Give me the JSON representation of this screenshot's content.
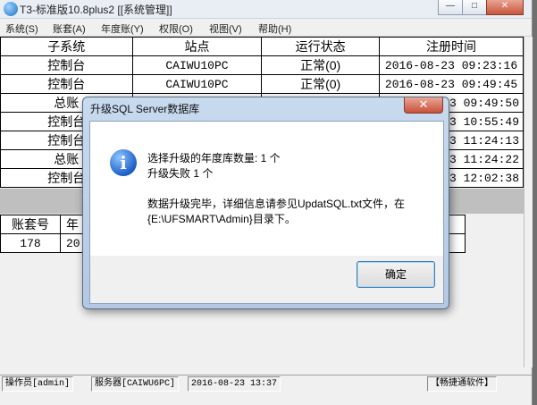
{
  "window": {
    "title": "T3-标准版10.8plus2 [[系统管理]]"
  },
  "menu": [
    "系统(S)",
    "账套(A)",
    "年度账(Y)",
    "权限(O)",
    "视图(V)",
    "帮助(H)"
  ],
  "table1": {
    "headers": [
      "子系统",
      "站点",
      "运行状态",
      "注册时间"
    ],
    "rows": [
      [
        "控制台",
        "CAIWU10PC",
        "正常(0)",
        "2016-08-23 09:23:16"
      ],
      [
        "控制台",
        "CAIWU10PC",
        "正常(0)",
        "2016-08-23 09:49:45"
      ],
      [
        "总账",
        "",
        "",
        "3 09:49:50"
      ],
      [
        "控制台",
        "",
        "",
        "3 10:55:49"
      ],
      [
        "控制台",
        "",
        "",
        "3 11:24:13"
      ],
      [
        "总账",
        "",
        "",
        "3 11:24:22"
      ],
      [
        "控制台",
        "",
        "",
        "3 12:02:38"
      ]
    ]
  },
  "table2": {
    "headers": [
      "账套号",
      "年"
    ],
    "rows": [
      [
        "178",
        "20"
      ]
    ]
  },
  "status": {
    "operator": "操作员[admin]",
    "server": "服务器[CAIWU6PC]",
    "datetime": "2016-08-23 13:37",
    "vendor": "【畅捷通软件】"
  },
  "dialog": {
    "title": "升级SQL Server数据库",
    "line1": "选择升级的年度库数量: 1 个",
    "line2": "升级失败 1 个",
    "line3": "数据升级完毕，详细信息请参见UpdatSQL.txt文件，在",
    "line4": "{E:\\UFSMART\\Admin}目录下。",
    "ok_label": "确定",
    "close_glyph": "✕",
    "icon_glyph": "i"
  }
}
